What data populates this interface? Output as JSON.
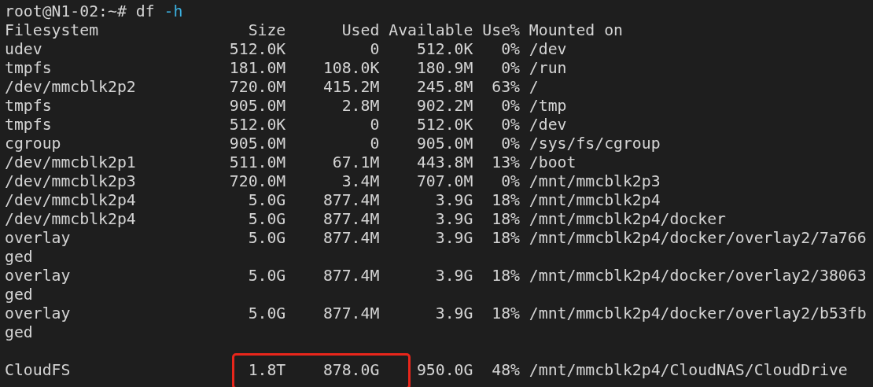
{
  "command_line": {
    "prompt": "root@N1-02:~#",
    "command": "df",
    "option": "-h"
  },
  "table": {
    "columns": [
      "Filesystem",
      "Size",
      "Used",
      "Available",
      "Use%",
      "Mounted on"
    ],
    "rows": [
      {
        "filesystem": "udev",
        "size": "512.0K",
        "used": "0",
        "available": "512.0K",
        "use_pct": "0%",
        "mounted_on": "/dev",
        "blank_before": false,
        "highlighted": false
      },
      {
        "filesystem": "tmpfs",
        "size": "181.0M",
        "used": "108.0K",
        "available": "180.9M",
        "use_pct": "0%",
        "mounted_on": "/run",
        "blank_before": false,
        "highlighted": false
      },
      {
        "filesystem": "/dev/mmcblk2p2",
        "size": "720.0M",
        "used": "415.2M",
        "available": "245.8M",
        "use_pct": "63%",
        "mounted_on": "/",
        "blank_before": false,
        "highlighted": false
      },
      {
        "filesystem": "tmpfs",
        "size": "905.0M",
        "used": "2.8M",
        "available": "902.2M",
        "use_pct": "0%",
        "mounted_on": "/tmp",
        "blank_before": false,
        "highlighted": false
      },
      {
        "filesystem": "tmpfs",
        "size": "512.0K",
        "used": "0",
        "available": "512.0K",
        "use_pct": "0%",
        "mounted_on": "/dev",
        "blank_before": false,
        "highlighted": false
      },
      {
        "filesystem": "cgroup",
        "size": "905.0M",
        "used": "0",
        "available": "905.0M",
        "use_pct": "0%",
        "mounted_on": "/sys/fs/cgroup",
        "blank_before": false,
        "highlighted": false
      },
      {
        "filesystem": "/dev/mmcblk2p1",
        "size": "511.0M",
        "used": "67.1M",
        "available": "443.8M",
        "use_pct": "13%",
        "mounted_on": "/boot",
        "blank_before": false,
        "highlighted": false
      },
      {
        "filesystem": "/dev/mmcblk2p3",
        "size": "720.0M",
        "used": "3.4M",
        "available": "707.0M",
        "use_pct": "0%",
        "mounted_on": "/mnt/mmcblk2p3",
        "blank_before": false,
        "highlighted": false
      },
      {
        "filesystem": "/dev/mmcblk2p4",
        "size": "5.0G",
        "used": "877.4M",
        "available": "3.9G",
        "use_pct": "18%",
        "mounted_on": "/mnt/mmcblk2p4",
        "blank_before": false,
        "highlighted": false
      },
      {
        "filesystem": "/dev/mmcblk2p4",
        "size": "5.0G",
        "used": "877.4M",
        "available": "3.9G",
        "use_pct": "18%",
        "mounted_on": "/mnt/mmcblk2p4/docker",
        "blank_before": false,
        "highlighted": false
      },
      {
        "filesystem": "overlay",
        "size": "5.0G",
        "used": "877.4M",
        "available": "3.9G",
        "use_pct": "18%",
        "mounted_on": "/mnt/mmcblk2p4/docker/overlay2/7a766",
        "wrapped": "ged",
        "blank_before": false,
        "highlighted": false
      },
      {
        "filesystem": "overlay",
        "size": "5.0G",
        "used": "877.4M",
        "available": "3.9G",
        "use_pct": "18%",
        "mounted_on": "/mnt/mmcblk2p4/docker/overlay2/38063",
        "wrapped": "ged",
        "blank_before": false,
        "highlighted": false
      },
      {
        "filesystem": "overlay",
        "size": "5.0G",
        "used": "877.4M",
        "available": "3.9G",
        "use_pct": "18%",
        "mounted_on": "/mnt/mmcblk2p4/docker/overlay2/b53fb",
        "wrapped": "ged",
        "blank_before": false,
        "highlighted": false
      },
      {
        "filesystem": "CloudFS",
        "size": "1.8T",
        "used": "878.0G",
        "available": "950.0G",
        "use_pct": "48%",
        "mounted_on": "/mnt/mmcblk2p4/CloudNAS/CloudDrive",
        "blank_before": true,
        "highlighted": true
      }
    ]
  }
}
